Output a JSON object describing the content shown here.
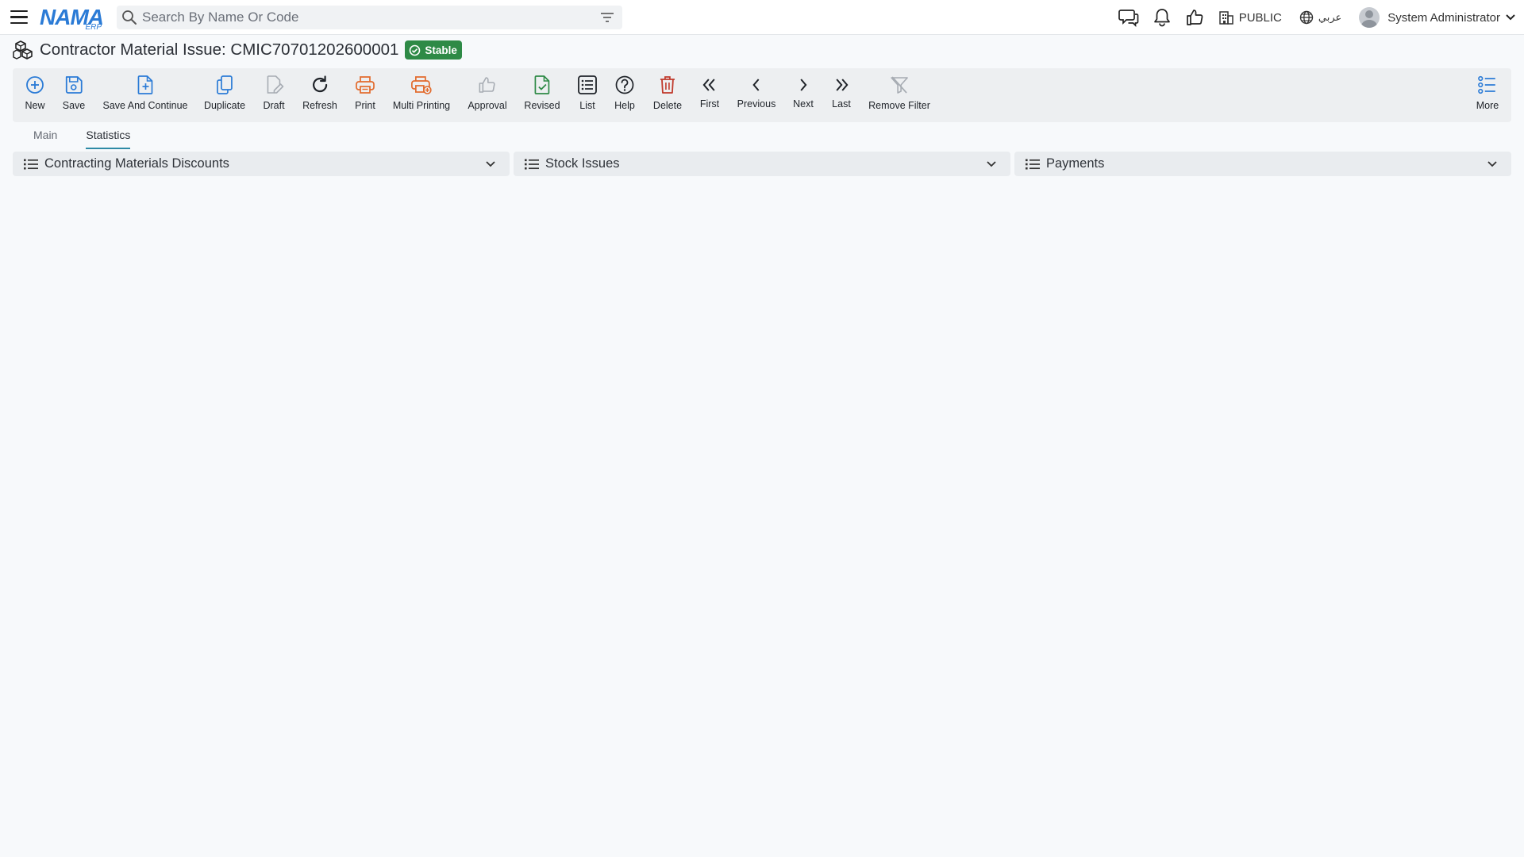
{
  "app": {
    "logo_text": "NAMA",
    "logo_sub": "ERP"
  },
  "search": {
    "placeholder": "Search By Name Or Code",
    "value": ""
  },
  "topbar": {
    "company": "PUBLIC",
    "language": "عربي",
    "user": "System Administrator"
  },
  "page": {
    "title": "Contractor Material Issue: CMIC70701202600001",
    "status": "Stable"
  },
  "toolbar": {
    "new": "New",
    "save": "Save",
    "save_continue": "Save And Continue",
    "duplicate": "Duplicate",
    "draft": "Draft",
    "refresh": "Refresh",
    "print": "Print",
    "multi_print": "Multi Printing",
    "approval": "Approval",
    "revised": "Revised",
    "list": "List",
    "help": "Help",
    "delete": "Delete",
    "first": "First",
    "previous": "Previous",
    "next": "Next",
    "last": "Last",
    "remove_filter": "Remove Filter",
    "more": "More"
  },
  "tabs": {
    "main": "Main",
    "statistics": "Statistics",
    "active": "statistics"
  },
  "panels": {
    "discounts": "Contracting Materials Discounts",
    "stock_issues": "Stock Issues",
    "payments": "Payments"
  },
  "colors": {
    "accent_blue": "#2b7bd6",
    "print_orange": "#e26a2c",
    "delete_red": "#c0392b",
    "revised_green": "#2e8a46",
    "status_green": "#2e8a46",
    "disabled_gray": "#a7acb3"
  }
}
